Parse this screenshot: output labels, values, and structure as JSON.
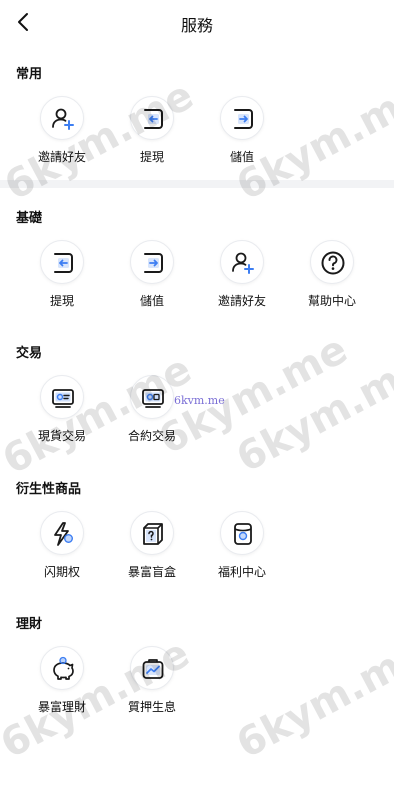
{
  "header": {
    "title": "服務",
    "back_icon": "chevron-left-icon"
  },
  "sections": [
    {
      "title": "常用",
      "items": [
        {
          "label": "邀請好友",
          "icon": "add-user-icon"
        },
        {
          "label": "提現",
          "icon": "withdraw-icon"
        },
        {
          "label": "儲值",
          "icon": "deposit-icon"
        }
      ]
    },
    {
      "title": "基礎",
      "items": [
        {
          "label": "提現",
          "icon": "withdraw-icon"
        },
        {
          "label": "儲值",
          "icon": "deposit-icon"
        },
        {
          "label": "邀請好友",
          "icon": "add-user-icon"
        },
        {
          "label": "幫助中心",
          "icon": "help-icon"
        }
      ]
    },
    {
      "title": "交易",
      "items": [
        {
          "label": "現貨交易",
          "icon": "spot-trade-icon"
        },
        {
          "label": "合約交易",
          "icon": "contract-trade-icon"
        }
      ]
    },
    {
      "title": "衍生性商品",
      "items": [
        {
          "label": "闪期权",
          "icon": "flash-option-icon"
        },
        {
          "label": "暴富盲盒",
          "icon": "blind-box-icon"
        },
        {
          "label": "福利中心",
          "icon": "welfare-icon"
        }
      ]
    },
    {
      "title": "理財",
      "items": [
        {
          "label": "暴富理財",
          "icon": "piggy-bank-icon"
        },
        {
          "label": "質押生息",
          "icon": "staking-icon"
        }
      ]
    }
  ],
  "watermark": {
    "text": "6kym.me",
    "small_text": "6kvm.me"
  },
  "colors": {
    "accent": "#3d7ef2",
    "dark": "#1a1a1a",
    "divider": "#f2f3f5"
  }
}
